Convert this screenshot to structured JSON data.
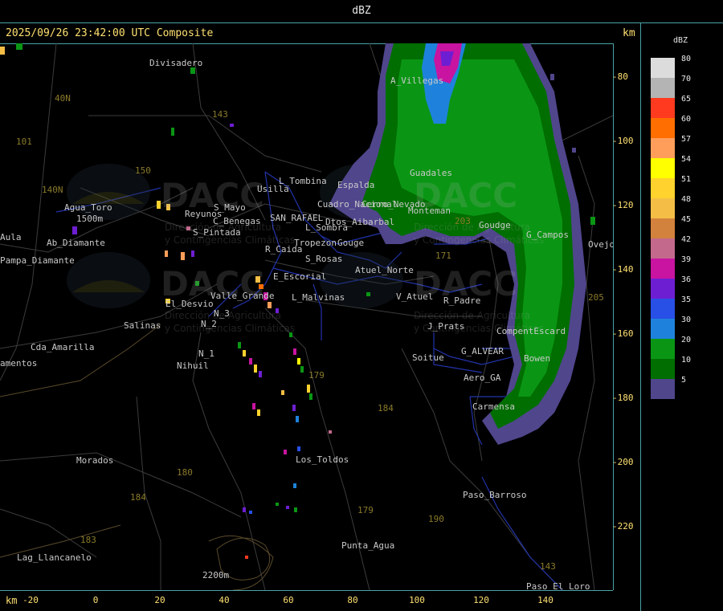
{
  "header": {
    "title": "dBZ"
  },
  "timestamp": "2025/09/26 23:42:00 UTC Composite",
  "axis_unit_top": "km",
  "axis_unit_bottom": "km",
  "x_ticks": [
    "-20",
    "0",
    "20",
    "40",
    "60",
    "80",
    "100",
    "120",
    "140"
  ],
  "y_ticks": [
    "-80",
    "-100",
    "-120",
    "-140",
    "-160",
    "-180",
    "-200",
    "-220"
  ],
  "legend": {
    "title": "dBZ",
    "items": [
      {
        "value": "80",
        "color": "#dcdcdc"
      },
      {
        "value": "70",
        "color": "#b4b4b4"
      },
      {
        "value": "65",
        "color": "#ff3a1e"
      },
      {
        "value": "60",
        "color": "#ff6e00"
      },
      {
        "value": "57",
        "color": "#ff9e5a"
      },
      {
        "value": "54",
        "color": "#ffff00"
      },
      {
        "value": "51",
        "color": "#ffd22d"
      },
      {
        "value": "48",
        "color": "#f4be46"
      },
      {
        "value": "45",
        "color": "#d2823c"
      },
      {
        "value": "42",
        "color": "#c3698c"
      },
      {
        "value": "39",
        "color": "#c814a0"
      },
      {
        "value": "36",
        "color": "#6e1ed2"
      },
      {
        "value": "35",
        "color": "#2850e6"
      },
      {
        "value": "30",
        "color": "#1e82dc"
      },
      {
        "value": "20",
        "color": "#0a9614"
      },
      {
        "value": "10",
        "color": "#006e00"
      },
      {
        "value": "5",
        "color": "#50468c"
      }
    ]
  },
  "places": [
    "Divisadero",
    "A_Villegas",
    "40N",
    "101",
    "150",
    "143",
    "Usilla",
    "L_Tombina",
    "Espalda",
    "Guadales",
    "Agua_Toro",
    "1500m",
    "Reyunos",
    "S_Mayo",
    "C_Benegas",
    "SAN_RAFAEL",
    "Monteman",
    "Goudge",
    "G_Campos",
    "Cuadro_Nacional",
    "L_Sombra",
    "Cerro_Nevado",
    "Dtos_Aibarbal",
    "R_Caida",
    "Tropezon",
    "Gouge",
    "S_Rosas",
    "Aula",
    "Pampa_Diamante",
    "S_Pintada",
    "E_Escorial",
    "Atuel_Norte",
    "171",
    "V_Atuel",
    "R_Padre",
    "L_Malvinas",
    "Valle_Grande",
    "El_Desvio",
    "N_3",
    "N_2",
    "N_1",
    "Salinas",
    "J_Prats",
    "CompentEscard",
    "Cda_Amarilla",
    "amentos",
    "Nihuil",
    "Soitue",
    "G_ALVEAR",
    "Bowen",
    "Aero_GA",
    "179",
    "184",
    "Carmensa",
    "Morados",
    "180",
    "Los_Toldos",
    "Paso_Barroso",
    "184",
    "179",
    "190",
    "Lag_Llancanelo",
    "183",
    "Punta_Agua",
    "2200m",
    "143",
    "Paso_El_Loro",
    "205",
    "Ovejo",
    "140N",
    "Ab_Diamante",
    "203"
  ],
  "watermark": {
    "brand": "DACC",
    "line1": "Dirección de Agricultura",
    "line2": "y Contingencias Climáticas"
  }
}
